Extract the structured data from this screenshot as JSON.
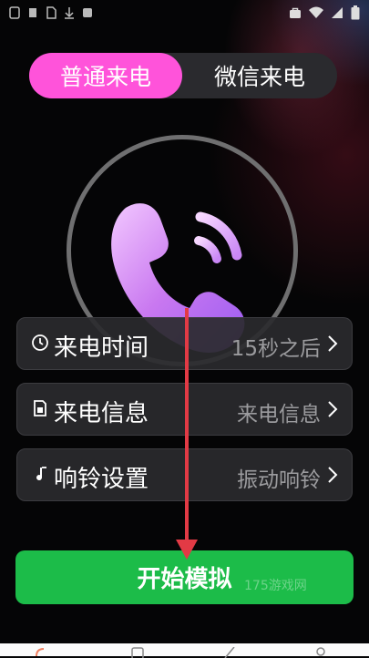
{
  "tabs": [
    {
      "label": "普通来电",
      "active": true
    },
    {
      "label": "微信来电",
      "active": false
    }
  ],
  "settings": [
    {
      "icon": "clock-icon",
      "label": "来电时间",
      "value": "15秒之后"
    },
    {
      "icon": "sim-card-icon",
      "label": "来电信息",
      "value": "来电信息"
    },
    {
      "icon": "ring-icon",
      "label": "响铃设置",
      "value": "振动响铃"
    }
  ],
  "start_button": {
    "label": "开始模拟"
  },
  "watermark": {
    "text": "175游戏网"
  },
  "colors": {
    "accent_pink": "#ff53da",
    "start_green": "#1cbc49",
    "arrow_red": "#e23a45",
    "row_bg": "#2a2a2e"
  }
}
